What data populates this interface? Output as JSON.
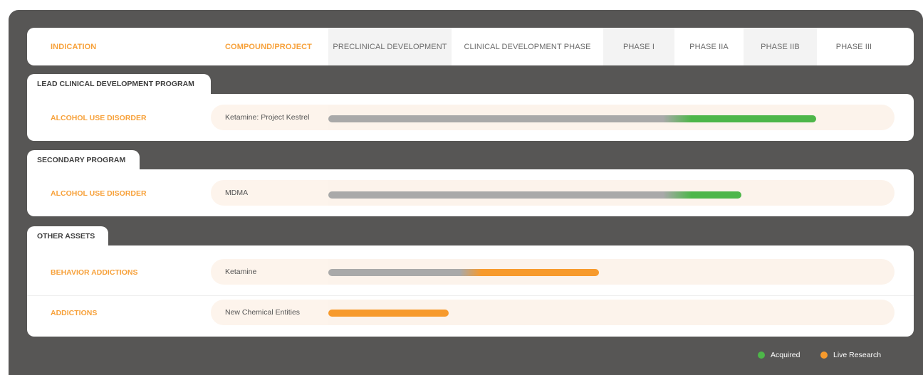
{
  "header": {
    "indication": "INDICATION",
    "compound": "COMPOUND/PROJECT",
    "phases": [
      "PRECLINICAL DEVELOPMENT",
      "CLINICAL DEVELOPMENT PHASE",
      "PHASE I",
      "PHASE IIA",
      "PHASE IIB",
      "PHASE III"
    ]
  },
  "groups": [
    {
      "label": "LEAD CLINICAL DEVELOPMENT PROGRAM",
      "rows": [
        {
          "indication": "ALCOHOL USE DISORDER",
          "compound": "Ketamine: Project Kestrel",
          "status": "Acquired",
          "reached_phase": "PHASE IIB"
        }
      ]
    },
    {
      "label": "SECONDARY PROGRAM",
      "rows": [
        {
          "indication": "ALCOHOL USE DISORDER",
          "compound": "MDMA",
          "status": "Acquired",
          "reached_phase": "PHASE IIA"
        }
      ]
    },
    {
      "label": "OTHER ASSETS",
      "rows": [
        {
          "indication": "BEHAVIOR ADDICTIONS",
          "compound": "Ketamine",
          "status": "Live Research",
          "reached_phase": "CLINICAL DEVELOPMENT PHASE"
        },
        {
          "indication": "ADDICTIONS",
          "compound": "New Chemical Entities",
          "status": "Live Research",
          "reached_phase": "PRECLINICAL DEVELOPMENT"
        }
      ]
    }
  ],
  "legend": [
    {
      "label": "Acquired",
      "color": "#4db649"
    },
    {
      "label": "Live Research",
      "color": "#f79a2c"
    }
  ],
  "colors": {
    "accent_orange": "#f7a13a",
    "acquired_green": "#4db649",
    "research_orange": "#f79a2c",
    "progress_gray": "#a9a9a9",
    "panel_dark": "#575655"
  }
}
